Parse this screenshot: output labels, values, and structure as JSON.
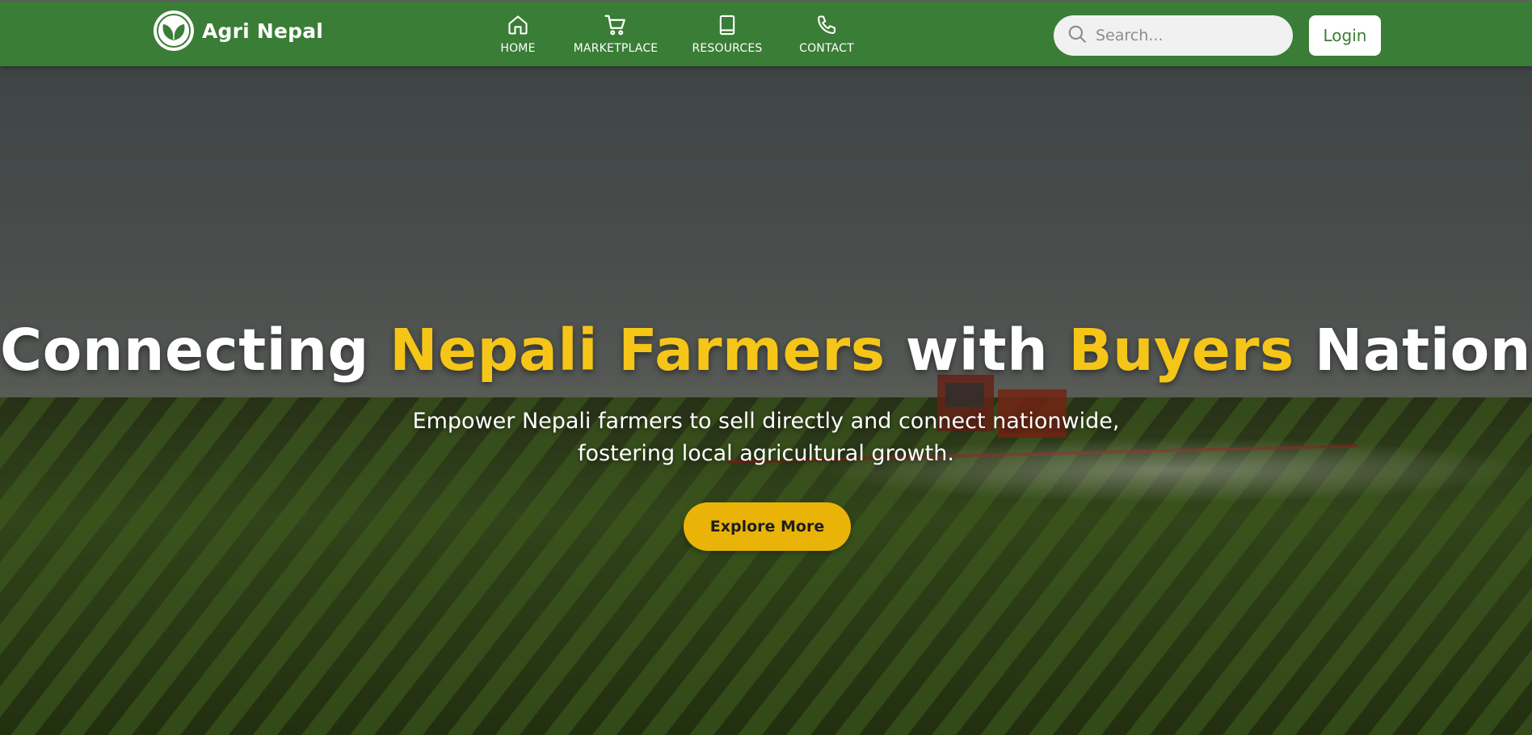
{
  "nav": {
    "brand": "Agri Nepal",
    "links": [
      {
        "label": "HOME",
        "icon": "home-icon"
      },
      {
        "label": "MARKETPLACE",
        "icon": "cart-icon"
      },
      {
        "label": "RESOURCES",
        "icon": "book-icon"
      },
      {
        "label": "CONTACT",
        "icon": "phone-icon"
      }
    ],
    "search_placeholder": "Search...",
    "login_label": "Login"
  },
  "hero": {
    "title_parts": [
      "Connecting ",
      "Nepali Farmers",
      " with ",
      "Buyers",
      " Nationwide"
    ],
    "subtitle_line1": "Empower Nepali farmers to sell directly and connect nationwide,",
    "subtitle_line2": "fostering local agricultural growth.",
    "cta_label": "Explore More"
  },
  "colors": {
    "nav_bg": "#3a7d36",
    "accent_yellow": "#f5c518",
    "button_yellow": "#eab308",
    "login_text": "#3a7d36"
  }
}
